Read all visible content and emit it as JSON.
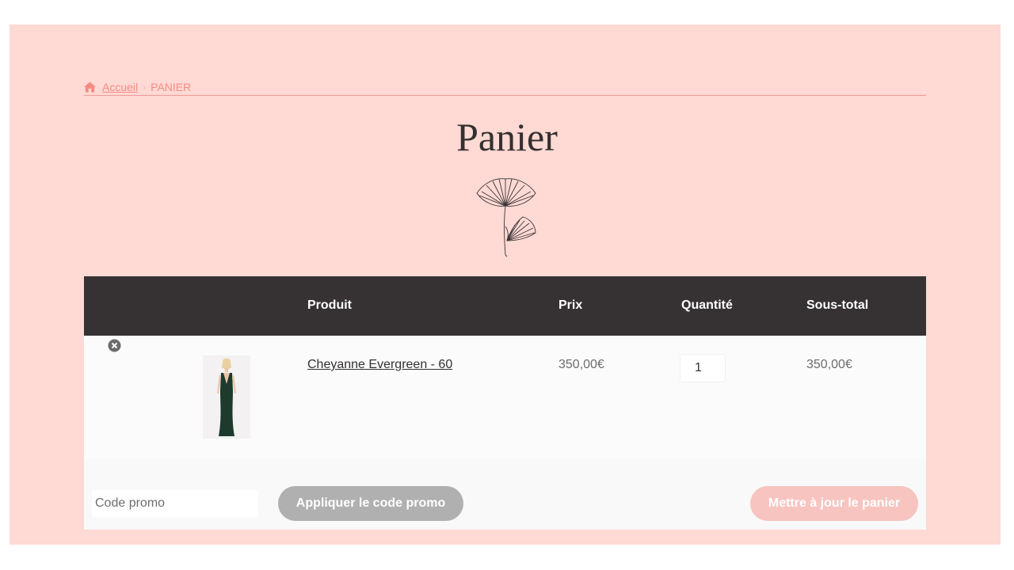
{
  "breadcrumb": {
    "home_label": "Accueil",
    "current": "PANIER",
    "separator": "›"
  },
  "page_title": "Panier",
  "table": {
    "headers": {
      "product": "Produit",
      "price": "Prix",
      "quantity": "Quantité",
      "subtotal": "Sous-total"
    },
    "rows": [
      {
        "product": "Cheyanne Evergreen - 60",
        "price": "350,00€",
        "quantity": "1",
        "subtotal": "350,00€"
      }
    ]
  },
  "actions": {
    "promo_placeholder": "Code promo",
    "apply_label": "Appliquer le code promo",
    "update_label": "Mettre à jour le panier"
  },
  "colors": {
    "page_background": "#ffd9d4",
    "header_background": "#363233",
    "accent": "#f48b84",
    "apply_button": "#b0b0b0",
    "update_button": "#f7c4c0"
  },
  "icons": [
    "home-icon",
    "ginkgo-leaf-decoration",
    "remove-item-icon"
  ]
}
